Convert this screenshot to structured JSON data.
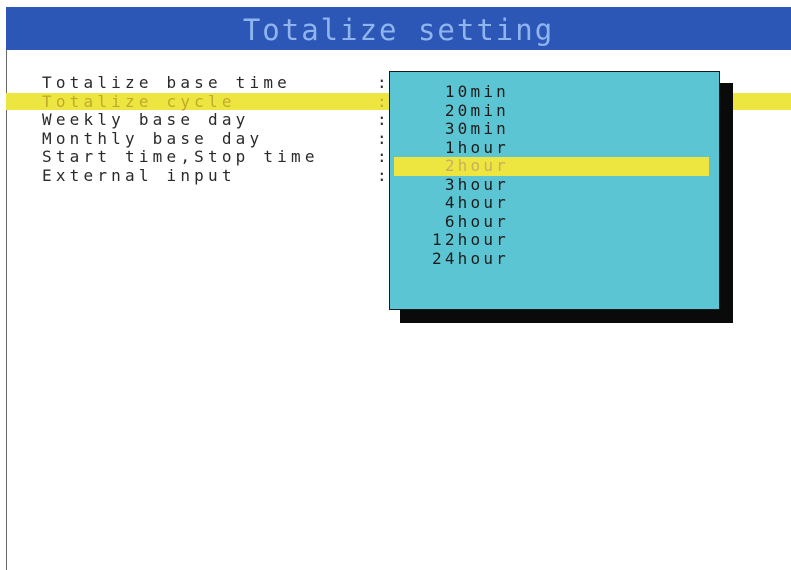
{
  "title": "Totalize setting",
  "settings": [
    {
      "label": "Totalize base time",
      "separator": ":"
    },
    {
      "label": "Totalize cycle",
      "separator": ":"
    },
    {
      "label": "Weekly base day",
      "separator": ":"
    },
    {
      "label": "Monthly base day",
      "separator": ":"
    },
    {
      "label": "Start time,Stop time",
      "separator": ":"
    },
    {
      "label": "External input",
      "separator": ":"
    }
  ],
  "selected_setting": "Totalize cycle",
  "dropdown": {
    "options": [
      "10min",
      "20min",
      "30min",
      "1hour",
      "2hour",
      "3hour",
      "4hour",
      "6hour",
      "12hour",
      "24hour"
    ],
    "selected": "2hour"
  },
  "colors": {
    "title_bar": "#2c57b6",
    "title_text": "#8fb4ee",
    "highlight": "#ede640",
    "dropdown_bg": "#5cc5d3",
    "shadow": "#0a0a0a"
  }
}
